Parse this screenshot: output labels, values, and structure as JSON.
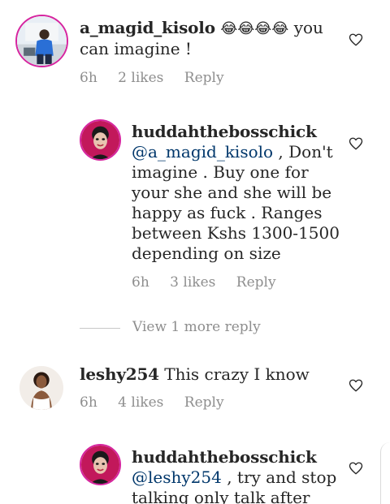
{
  "comments": [
    {
      "username": "a_magid_kisolo",
      "text_before": " ",
      "emoji": "😂😂😂😂",
      "text_after": " you can imagine !",
      "time": "6h",
      "likes": "2 likes",
      "reply": "Reply"
    },
    {
      "username": "huddahthebosschick",
      "mention": "@a_magid_kisolo",
      "text": " , Don't imagine . Buy one for your she and she will be happy as fuck . Ranges between Kshs 1300-1500 depending on size",
      "time": "6h",
      "likes": "3 likes",
      "reply": "Reply"
    },
    {
      "username": "leshy254",
      "text": " This crazy I know",
      "time": "6h",
      "likes": "4 likes",
      "reply": "Reply"
    },
    {
      "username": "huddahthebosschick",
      "mention": "@leshy254",
      "text": " , try and stop talking only talk after",
      "time": "",
      "likes": "",
      "reply": ""
    }
  ],
  "view_more": "View 1 more reply",
  "icons": {
    "like": "heart-outline-icon"
  },
  "colors": {
    "ring": "#d6249f",
    "mention": "#00376b",
    "meta": "#8e8e8e"
  }
}
